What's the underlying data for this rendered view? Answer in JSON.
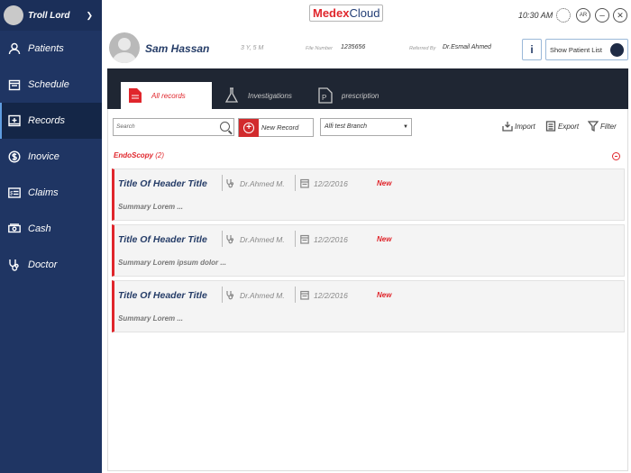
{
  "app": {
    "logo_prefix": "Medex",
    "logo_suffix": "Cloud",
    "time": "10:30 AM",
    "lang": "AR"
  },
  "user": {
    "name": "Troll Lord"
  },
  "sidebar": {
    "items": [
      {
        "label": "Patients",
        "icon": "person-icon"
      },
      {
        "label": "Schedule",
        "icon": "calendar-icon"
      },
      {
        "label": "Records",
        "icon": "records-icon",
        "active": true
      },
      {
        "label": "Inovice",
        "icon": "dollar-icon"
      },
      {
        "label": "Claims",
        "icon": "claims-icon"
      },
      {
        "label": "Cash",
        "icon": "cash-icon"
      },
      {
        "label": "Doctor",
        "icon": "stethoscope-icon"
      }
    ]
  },
  "patient": {
    "name": "Sam Hassan",
    "age": "3 Y, 5 M",
    "file_label": "File Number",
    "file_value": "1235656",
    "referred_label": "Referred By",
    "referred_value": "Dr.Esmail Ahmed",
    "info_label": "i",
    "show_list_label": "Show Patient List"
  },
  "tabs": [
    {
      "label": "All records",
      "active": true
    },
    {
      "label": "Investigations"
    },
    {
      "label": "prescription"
    }
  ],
  "toolbar": {
    "search_placeholder": "Search",
    "new_record_label": "New Record",
    "branch_value": "Alfi test Branch",
    "import_label": "Import",
    "export_label": "Export",
    "filter_label": "Filter"
  },
  "section": {
    "title": "EndoScopy",
    "count": "(2)"
  },
  "records": [
    {
      "title": "Title Of Header Title",
      "doctor": "Dr.Ahmed M.",
      "date": "12/2/2016",
      "status": "New",
      "summary": "Summary Lorem   ..."
    },
    {
      "title": "Title Of Header Title",
      "doctor": "Dr.Ahmed M.",
      "date": "12/2/2016",
      "status": "New",
      "summary": "Summary Lorem ipsum dolor   ..."
    },
    {
      "title": "Title Of Header Title",
      "doctor": "Dr.Ahmed M.",
      "date": "12/2/2016",
      "status": "New",
      "summary": "Summary Lorem   ..."
    }
  ],
  "colors": {
    "sidebar": "#1f3563",
    "accent_red": "#e0262c",
    "navy_text": "#263d68",
    "tab_bar": "#1f2633"
  }
}
